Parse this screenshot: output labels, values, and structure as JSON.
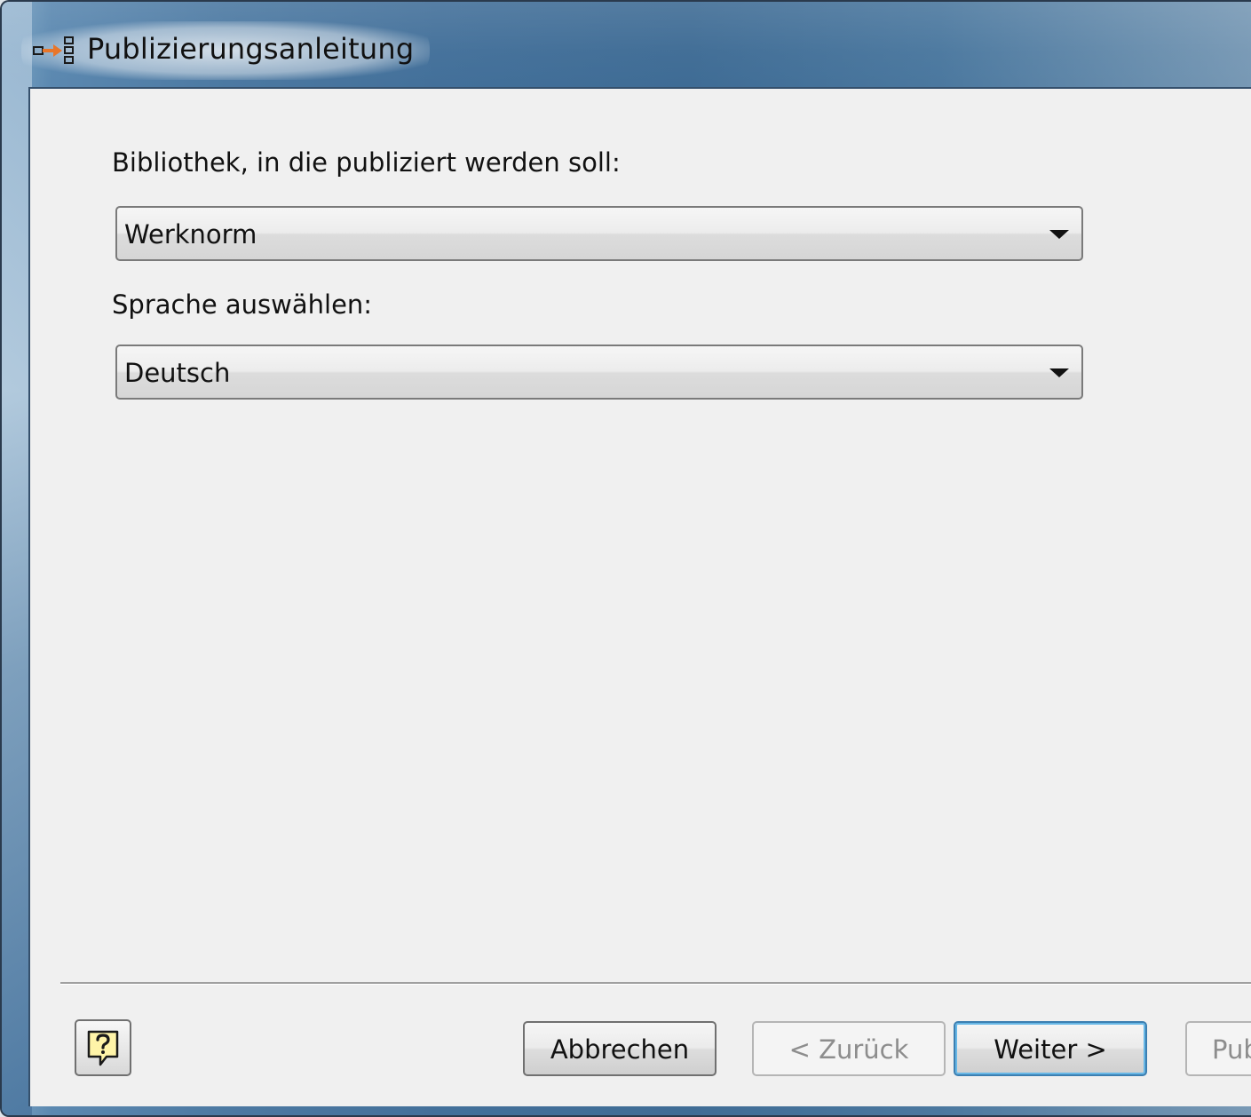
{
  "window": {
    "title": "Publizierungsanleitung",
    "icon": "publish-wizard-icon"
  },
  "form": {
    "library_label": "Bibliothek, in die publiziert werden soll:",
    "library_value": "Werknorm",
    "language_label": "Sprache auswählen:",
    "language_value": "Deutsch"
  },
  "footer": {
    "help_icon": "help-question-icon",
    "cancel_label": "Abbrechen",
    "back_label": "< Zurück",
    "back_enabled": false,
    "next_label": "Weiter >",
    "publish_label": "Pub",
    "publish_enabled": false
  },
  "colors": {
    "titlebar_blue": "#43709a",
    "client_background": "#f0f0f0",
    "default_button_border": "#3c7fb1"
  }
}
